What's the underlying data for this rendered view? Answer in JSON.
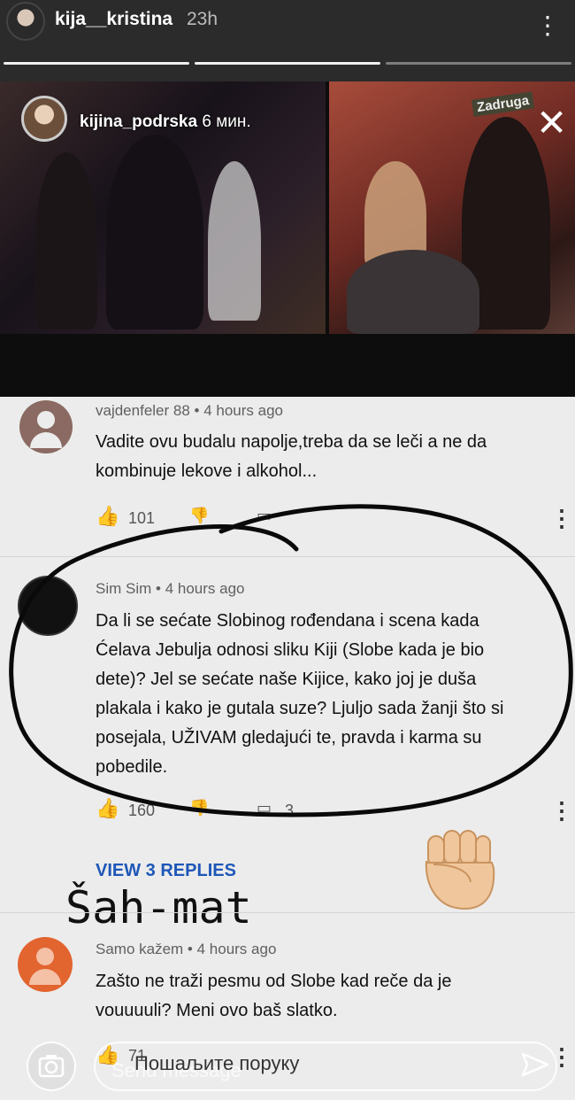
{
  "story": {
    "username": "kija__kristina",
    "time": "23h",
    "more": "⋮",
    "close": "✕"
  },
  "video": {
    "inner_username": "kijina_podrska",
    "inner_time": "6 мин.",
    "watermark": "Zadruga"
  },
  "comments": [
    {
      "author": "vajdenfeler 88",
      "time": "4 hours ago",
      "text_lines": [
        "Vadite ovu budalu napolje,treba da se leči a ne da",
        "kombinuje lekove i alkohol..."
      ],
      "likes": "101"
    },
    {
      "author": "Sim Sim",
      "time": "4 hours ago",
      "text_lines": [
        "Da li se sećate Slobinog rođendana i scena kada",
        "Ćelava Jebulja odnosi sliku Kiji (Slobe kada je bio",
        "dete)? Jel se sećate naše Kijice, kako joj je duša",
        "plakala i kako je gutala suze? Ljuljo sada žanji što si",
        "posejala, UŽIVAM gledajući te, pravda i karma su",
        "pobedile."
      ],
      "likes": "160",
      "replies_count": "3"
    },
    {
      "author": "Samo kažem",
      "time": "4 hours ago",
      "text_lines": [
        "Zašto ne traži pesmu od Slobe kad reče da je",
        "vouuuuli? Meni ovo baš slatko."
      ],
      "likes": "71"
    }
  ],
  "view_replies": "VIEW 3 REPLIES",
  "overlay_text": "Šah-mat",
  "message": {
    "placeholder_ru": "Пошаљите поруку",
    "placeholder_en": "Send message"
  },
  "colors": {
    "accent_blue": "#1e57b8",
    "bg_dark": "#2b2b2b",
    "comments_bg": "#ececec"
  }
}
